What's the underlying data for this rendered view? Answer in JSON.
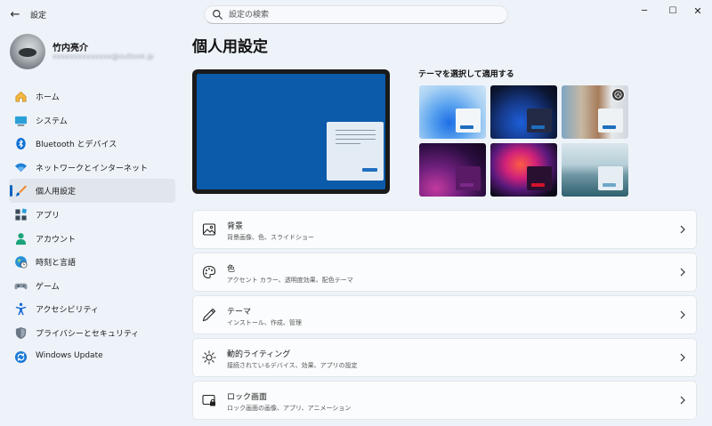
{
  "window": {
    "title": "設定",
    "back_icon": "←",
    "minimize_icon": "─",
    "maximize_icon": "☐",
    "close_icon": "✕"
  },
  "search": {
    "placeholder": "設定の検索"
  },
  "profile": {
    "name": "竹内亮介",
    "email": "xxxxxxxxxxxxxx@outlook.jp"
  },
  "sidebar": {
    "items": [
      {
        "label": "ホーム",
        "icon": "home-icon",
        "active": false
      },
      {
        "label": "システム",
        "icon": "system-icon",
        "active": false
      },
      {
        "label": "Bluetooth とデバイス",
        "icon": "bluetooth-icon",
        "active": false
      },
      {
        "label": "ネットワークとインターネット",
        "icon": "wifi-icon",
        "active": false
      },
      {
        "label": "個人用設定",
        "icon": "brush-icon",
        "active": true
      },
      {
        "label": "アプリ",
        "icon": "apps-icon",
        "active": false
      },
      {
        "label": "アカウント",
        "icon": "account-icon",
        "active": false
      },
      {
        "label": "時刻と言語",
        "icon": "time-language-icon",
        "active": false
      },
      {
        "label": "ゲーム",
        "icon": "gamepad-icon",
        "active": false
      },
      {
        "label": "アクセシビリティ",
        "icon": "accessibility-icon",
        "active": false
      },
      {
        "label": "プライバシーとセキュリティ",
        "icon": "shield-icon",
        "active": false
      },
      {
        "label": "Windows Update",
        "icon": "update-icon",
        "active": false
      }
    ]
  },
  "main": {
    "title": "個人用設定",
    "themes_title": "テーマを選択して適用する",
    "cards": [
      {
        "title": "背景",
        "subtitle": "背景画像、色、スライドショー",
        "icon": "picture-icon"
      },
      {
        "title": "色",
        "subtitle": "アクセント カラー、透明度効果、配色テーマ",
        "icon": "palette-icon"
      },
      {
        "title": "テーマ",
        "subtitle": "インストール、作成、管理",
        "icon": "pen-icon"
      },
      {
        "title": "動的ライティング",
        "subtitle": "接続されているデバイス、効果、アプリの設定",
        "icon": "lighting-icon"
      },
      {
        "title": "ロック画面",
        "subtitle": "ロック画面の画像、アプリ、アニメーション",
        "icon": "lock-screen-icon"
      }
    ]
  },
  "colors": {
    "accent": "#0a62bf",
    "preview_background": "#0c5aaa",
    "theme_button_blue": "#1f6fbf",
    "theme_button_red": "#d3122a"
  }
}
